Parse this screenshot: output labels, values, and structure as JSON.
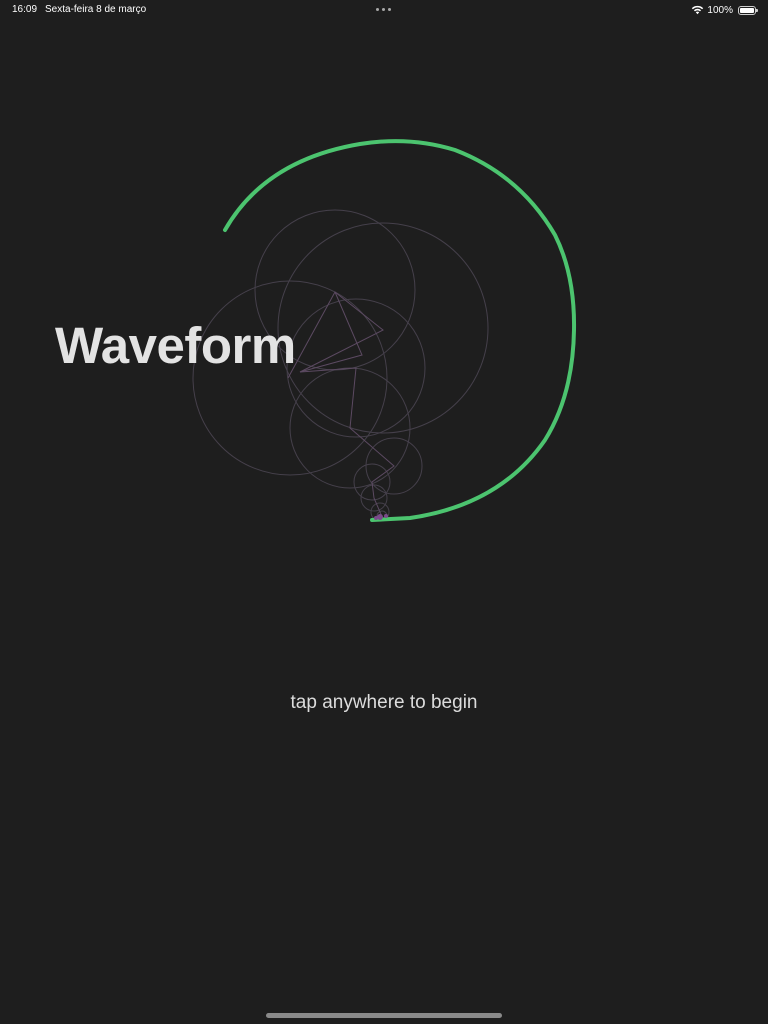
{
  "status_bar": {
    "time": "16:09",
    "date": "Sexta-feira 8 de março",
    "battery_percent": "100%",
    "battery_level": 1.0,
    "icons": [
      "more-dots-icon",
      "wifi-icon",
      "battery-icon"
    ]
  },
  "app": {
    "title": "Waveform",
    "prompt": "tap anywhere to begin"
  },
  "colors": {
    "background": "#1e1e1e",
    "waveform_trace": "#4cc46f",
    "epicycle_lines": "#5a4f5a",
    "title_text": "#e3e3e3"
  }
}
